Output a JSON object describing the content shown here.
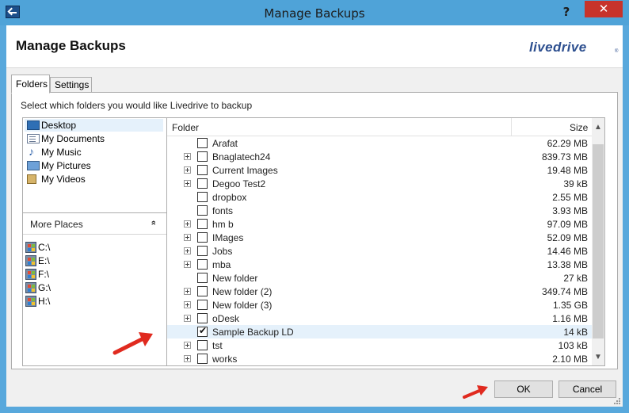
{
  "window": {
    "title": "Manage Backups",
    "help_label": "?",
    "close_label": "✕"
  },
  "header": {
    "title": "Manage Backups",
    "logo": "livedrive",
    "logo_mark": "®"
  },
  "tabs": [
    {
      "label": "Folders"
    },
    {
      "label": "Settings"
    }
  ],
  "instruction": "Select which folders you would like Livedrive to backup",
  "locations": [
    {
      "label": "Desktop",
      "icon": "desktop-icon"
    },
    {
      "label": "My Documents",
      "icon": "documents-icon"
    },
    {
      "label": "My Music",
      "icon": "music-icon"
    },
    {
      "label": "My Pictures",
      "icon": "pictures-icon"
    },
    {
      "label": "My Videos",
      "icon": "videos-icon"
    }
  ],
  "more_places": {
    "label": "More Places",
    "toggle": "»"
  },
  "drives": [
    {
      "label": "C:\\"
    },
    {
      "label": "E:\\"
    },
    {
      "label": "F:\\"
    },
    {
      "label": "G:\\"
    },
    {
      "label": "H:\\"
    }
  ],
  "columns": {
    "folder": "Folder",
    "size": "Size"
  },
  "rows": [
    {
      "name": "Arafat",
      "size": "62.29 MB",
      "expand": false,
      "checked": false
    },
    {
      "name": "Bnaglatech24",
      "size": "839.73 MB",
      "expand": true,
      "checked": false
    },
    {
      "name": "Current Images",
      "size": "19.48 MB",
      "expand": true,
      "checked": false
    },
    {
      "name": "Degoo Test2",
      "size": "39 kB",
      "expand": true,
      "checked": false
    },
    {
      "name": "dropbox",
      "size": "2.55 MB",
      "expand": false,
      "checked": false
    },
    {
      "name": "fonts",
      "size": "3.93 MB",
      "expand": false,
      "checked": false
    },
    {
      "name": "hm b",
      "size": "97.09 MB",
      "expand": true,
      "checked": false
    },
    {
      "name": "IMages",
      "size": "52.09 MB",
      "expand": true,
      "checked": false
    },
    {
      "name": "Jobs",
      "size": "14.46 MB",
      "expand": true,
      "checked": false
    },
    {
      "name": "mba",
      "size": "13.38 MB",
      "expand": true,
      "checked": false
    },
    {
      "name": "New folder",
      "size": "27 kB",
      "expand": false,
      "checked": false
    },
    {
      "name": "New folder (2)",
      "size": "349.74 MB",
      "expand": true,
      "checked": false
    },
    {
      "name": "New folder (3)",
      "size": "1.35 GB",
      "expand": true,
      "checked": false
    },
    {
      "name": "oDesk",
      "size": "1.16 MB",
      "expand": true,
      "checked": false
    },
    {
      "name": "Sample Backup LD",
      "size": "14 kB",
      "expand": false,
      "checked": true
    },
    {
      "name": "tst",
      "size": "103 kB",
      "expand": true,
      "checked": false
    },
    {
      "name": "works",
      "size": "2.10 MB",
      "expand": true,
      "checked": false
    }
  ],
  "buttons": {
    "ok": "OK",
    "cancel": "Cancel"
  },
  "colors": {
    "titlebar": "#4fa3d8",
    "close": "#c7332b",
    "selection": "#e5f1fb",
    "arrow": "#e02a1f",
    "logo": "#2d4f8f"
  }
}
